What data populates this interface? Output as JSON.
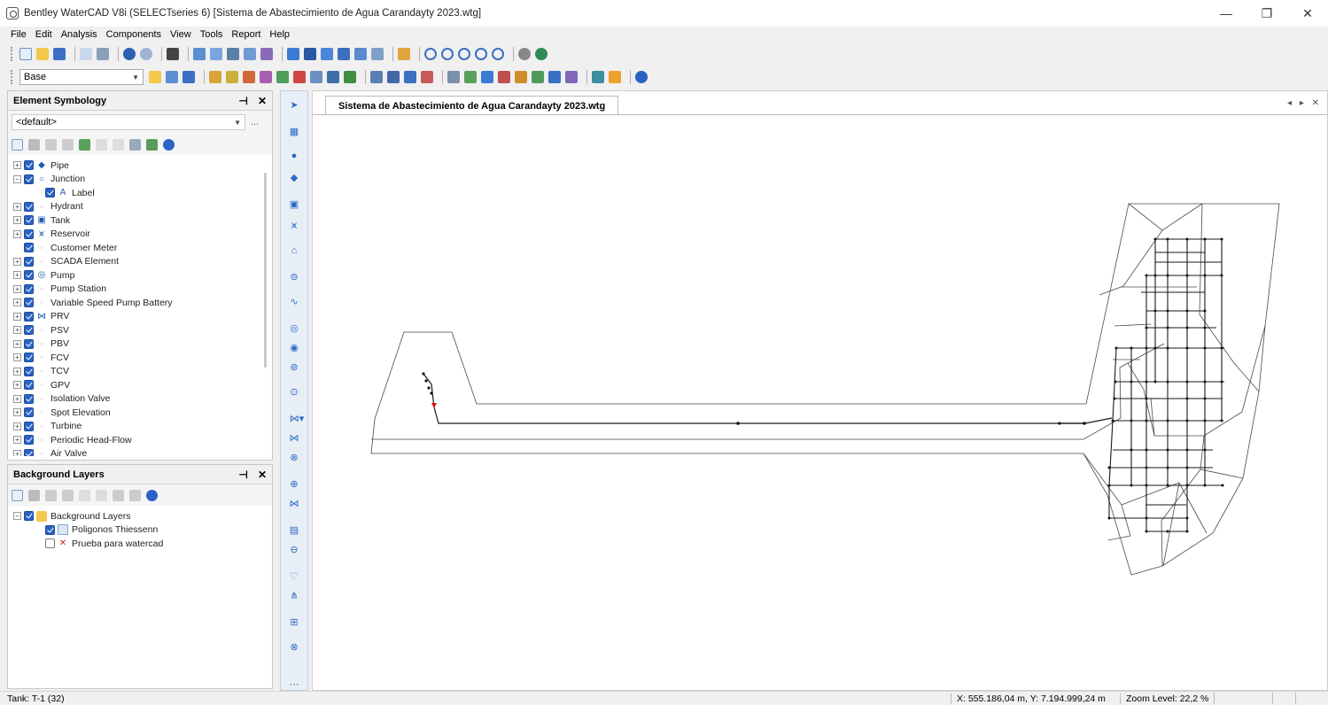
{
  "window": {
    "title": "Bentley WaterCAD V8i (SELECTseries 6) [Sistema de Abastecimiento de Agua Carandayty 2023.wtg]",
    "minimize": "—",
    "maximize": "❐",
    "close": "✕"
  },
  "menu": [
    "File",
    "Edit",
    "Analysis",
    "Components",
    "View",
    "Tools",
    "Report",
    "Help"
  ],
  "toolbar": {
    "scenario_combo": "Base"
  },
  "element_symbology": {
    "title": "Element Symbology",
    "pin": "⊣",
    "close": "✕",
    "combo_value": "<default>",
    "more": "...",
    "items": [
      {
        "label": "Pipe",
        "exp": "+",
        "icon": "pipe-icon",
        "glyph": "◆"
      },
      {
        "label": "Junction",
        "exp": "−",
        "icon": "junction-icon",
        "glyph": "○"
      },
      {
        "label": "Label",
        "exp": "",
        "icon": "label-icon",
        "glyph": "A",
        "indent": true
      },
      {
        "label": "Hydrant",
        "exp": "+",
        "icon": "hydrant-icon",
        "glyph": "▫",
        "small": true
      },
      {
        "label": "Tank",
        "exp": "+",
        "icon": "tank-icon",
        "glyph": "▣"
      },
      {
        "label": "Reservoir",
        "exp": "+",
        "icon": "reservoir-icon",
        "glyph": "⩙"
      },
      {
        "label": "Customer Meter",
        "exp": "",
        "icon": "customer-meter-icon",
        "glyph": "▫",
        "small": true
      },
      {
        "label": "SCADA Element",
        "exp": "+",
        "icon": "scada-icon",
        "glyph": "▫",
        "small": true
      },
      {
        "label": "Pump",
        "exp": "+",
        "icon": "pump-icon",
        "glyph": "◎"
      },
      {
        "label": "Pump Station",
        "exp": "+",
        "icon": "pump-station-icon",
        "glyph": "▫",
        "small": true
      },
      {
        "label": "Variable Speed Pump Battery",
        "exp": "+",
        "icon": "vspb-icon",
        "glyph": "▫",
        "small": true
      },
      {
        "label": "PRV",
        "exp": "+",
        "icon": "prv-icon",
        "glyph": "⋈"
      },
      {
        "label": "PSV",
        "exp": "+",
        "icon": "psv-icon",
        "glyph": "▫",
        "small": true
      },
      {
        "label": "PBV",
        "exp": "+",
        "icon": "pbv-icon",
        "glyph": "▫",
        "small": true
      },
      {
        "label": "FCV",
        "exp": "+",
        "icon": "fcv-icon",
        "glyph": "▫",
        "small": true
      },
      {
        "label": "TCV",
        "exp": "+",
        "icon": "tcv-icon",
        "glyph": "▫",
        "small": true
      },
      {
        "label": "GPV",
        "exp": "+",
        "icon": "gpv-icon",
        "glyph": "▫",
        "small": true
      },
      {
        "label": "Isolation Valve",
        "exp": "+",
        "icon": "isolation-valve-icon",
        "glyph": "▫",
        "small": true
      },
      {
        "label": "Spot Elevation",
        "exp": "+",
        "icon": "spot-elevation-icon",
        "glyph": "▫",
        "small": true
      },
      {
        "label": "Turbine",
        "exp": "+",
        "icon": "turbine-icon",
        "glyph": "▫",
        "small": true
      },
      {
        "label": "Periodic Head-Flow",
        "exp": "+",
        "icon": "periodic-head-flow-icon",
        "glyph": "▫",
        "small": true
      },
      {
        "label": "Air Valve",
        "exp": "+",
        "icon": "air-valve-icon",
        "glyph": "▫",
        "small": true
      }
    ]
  },
  "background_layers": {
    "title": "Background Layers",
    "pin": "⊣",
    "close": "✕",
    "items": [
      {
        "label": "Background Layers",
        "exp": "−",
        "checked": true,
        "icon": "folder-icon"
      },
      {
        "label": "Poligonos Thiessenn",
        "exp": "",
        "checked": true,
        "icon": "layer-icon"
      },
      {
        "label": "Prueba para watercad",
        "exp": "",
        "checked": false,
        "icon": "missing-layer-icon"
      }
    ]
  },
  "document": {
    "tab": "Sistema de Abastecimiento de Agua Carandayty 2023.wtg",
    "controls": "◂ ▸ ✕"
  },
  "status": {
    "left": "Tank:  T-1 (32)",
    "coords": "X: 555.186,04 m, Y: 7.194.999,24 m",
    "zoom": "Zoom Level: 22,2 %"
  },
  "colors": {
    "accent": "#2a63c5",
    "reservoir_marker": "#e0101a",
    "network_line": "#1a1a1a",
    "polygon_line": "#4a4a4a"
  }
}
